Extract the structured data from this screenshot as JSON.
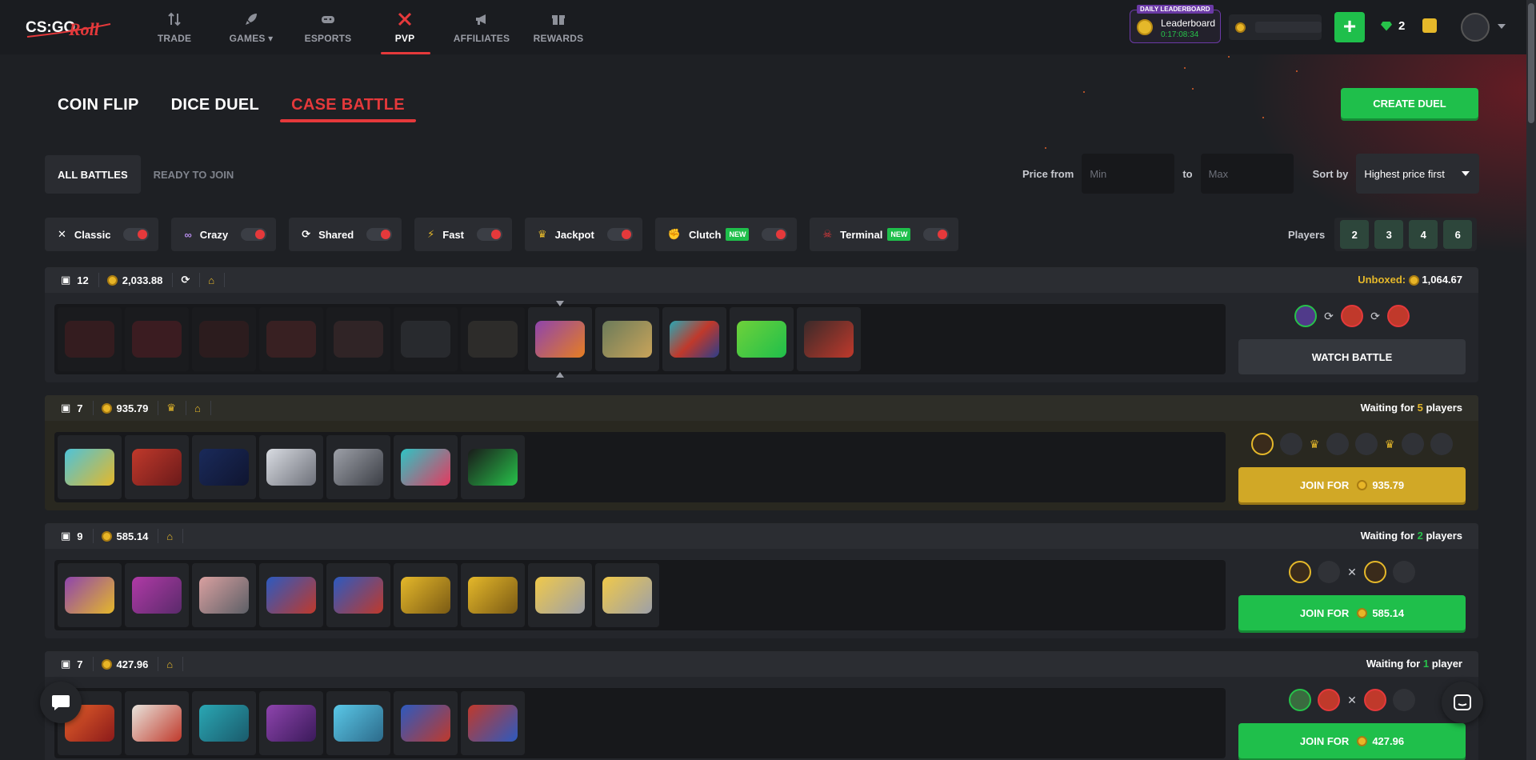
{
  "brand": {
    "logo_text": "CS:GO ROLL",
    "accent": "#e5393b",
    "green": "#1fbf4b",
    "gold": "#e5b82a"
  },
  "nav": [
    {
      "label": "TRADE",
      "icon": "arrows-updown-icon"
    },
    {
      "label": "GAMES ▾",
      "icon": "rocket-icon"
    },
    {
      "label": "ESPORTS",
      "icon": "gamepad-icon"
    },
    {
      "label": "PVP",
      "icon": "crossed-swords-icon",
      "active": true
    },
    {
      "label": "AFFILIATES",
      "icon": "megaphone-icon"
    },
    {
      "label": "REWARDS",
      "icon": "gift-icon"
    }
  ],
  "leaderboard": {
    "tag": "DAILY LEADERBOARD",
    "title": "Leaderboard",
    "time": "0:17:08:34"
  },
  "header": {
    "plus": "+",
    "gems": "2"
  },
  "modes": [
    "COIN FLIP",
    "DICE DUEL",
    "CASE BATTLE"
  ],
  "create_label": "CREATE DUEL",
  "filter_tabs": [
    "ALL BATTLES",
    "READY TO JOIN"
  ],
  "price": {
    "label": "Price from",
    "min": "Min",
    "to": "to",
    "max": "Max"
  },
  "sort": {
    "label": "Sort by",
    "value": "Highest price first"
  },
  "chips": [
    {
      "label": "Classic",
      "icon": "swords-icon"
    },
    {
      "label": "Crazy",
      "icon": "bike-icon"
    },
    {
      "label": "Shared",
      "icon": "share-icon"
    },
    {
      "label": "Fast",
      "icon": "lightning-icon"
    },
    {
      "label": "Jackpot",
      "icon": "crown-icon"
    },
    {
      "label": "Clutch",
      "icon": "fist-icon",
      "badge": "NEW"
    },
    {
      "label": "Terminal",
      "icon": "skull-icon",
      "badge": "NEW"
    }
  ],
  "players_filter": {
    "label": "Players",
    "options": [
      "2",
      "3",
      "4",
      "6"
    ]
  },
  "battles": [
    {
      "cases_count": "12",
      "price": "2,033.88",
      "right_prefix": "Unboxed:",
      "right_value": "1,064.67",
      "action": "WATCH BATTLE"
    },
    {
      "cases_count": "7",
      "price": "935.79",
      "right_prefix": "Waiting for ",
      "count": "5",
      "right_suffix": " players",
      "action": "JOIN FOR",
      "action_price": "935.79"
    },
    {
      "cases_count": "9",
      "price": "585.14",
      "right_prefix": "Waiting for ",
      "count": "2",
      "right_suffix": " players",
      "action": "JOIN FOR",
      "action_price": "585.14"
    },
    {
      "cases_count": "7",
      "price": "427.96",
      "right_prefix": "Waiting for ",
      "count": "1",
      "right_suffix": " player",
      "action": "JOIN FOR",
      "action_price": "427.96"
    }
  ]
}
